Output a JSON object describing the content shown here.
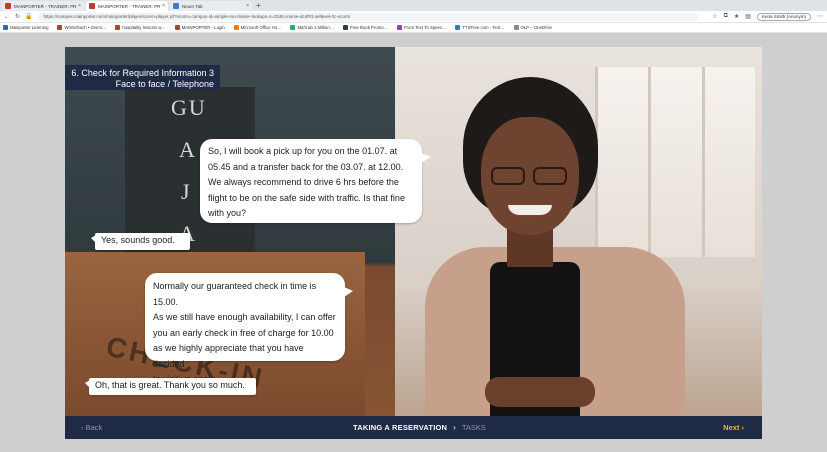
{
  "browser": {
    "tabs": [
      {
        "label": "MAINPORTER - TRAINER: PROK",
        "icon": "m-logo-icon",
        "active": false
      },
      {
        "label": "MAINPORTER - TRAINER: PROK",
        "icon": "m-logo-icon",
        "active": true
      },
      {
        "label": "Neuer Tab",
        "icon": "new-tab-icon",
        "active": false
      }
    ],
    "new_tab": "+",
    "close_glyph": "×",
    "url": "https://campus.mainporter.com/mainporter/player/scorm-player.jsf?scorm=campus-id=simple-run-trainer-lookups-4=2246.course-dc4f#3.setlevel-rtc-scorm",
    "profile": "Kena Smith (Anonym)",
    "bookmarks": [
      {
        "label": "Mainporter Learning",
        "color": "#2b6cb0"
      },
      {
        "label": "Wörterbuch • Overs…",
        "color": "#c0392b"
      },
      {
        "label": "hospitality lessons w…",
        "color": "#c0392b"
      },
      {
        "label": "MAINPORTER - Login",
        "color": "#c0392b"
      },
      {
        "label": "Microsoft Office Ho…",
        "color": "#e67e22"
      },
      {
        "label": "Mahl ab 1 Million…",
        "color": "#27ae60"
      },
      {
        "label": "Free Book Promo…",
        "color": "#2c3e50"
      },
      {
        "label": "From Text To Speec…",
        "color": "#8e44ad"
      },
      {
        "label": "TTSFree.com - Text…",
        "color": "#2980b9"
      },
      {
        "label": "OLP – OneDrive",
        "color": "#7f8c8d"
      }
    ]
  },
  "lesson": {
    "heading_line1": "6. Check for Required Information 3",
    "heading_line2": "Face to face / Telephone",
    "background_letters": [
      "GU",
      "A",
      "J",
      "A"
    ],
    "counter_text": "CHECK-IN",
    "bubbles": {
      "agent_1": [
        "So, I will book a pick up for you on the 01.07. at",
        "05.45 and a transfer back for the 03.07. at 12.00.",
        "We always recommend to drive 6 hrs before the",
        "flight to be on the safe side with traffic. Is that fine",
        "with you?"
      ],
      "guest_1": "Yes, sounds good.",
      "agent_2": [
        "Normally our guaranteed check in time is 15.00.",
        "As we still have enough availability, I can offer",
        "you an early check in free of charge for 10.00",
        "as we highly appreciate that you have decided",
        "to visit us again."
      ],
      "guest_2": "Oh, that is great. Thank you so much."
    }
  },
  "footer": {
    "back_label": "‹ Back",
    "current_step": "TAKING A RESERVATION",
    "separator": "›",
    "next_step": "TASKS",
    "next_label": "Next ›"
  }
}
